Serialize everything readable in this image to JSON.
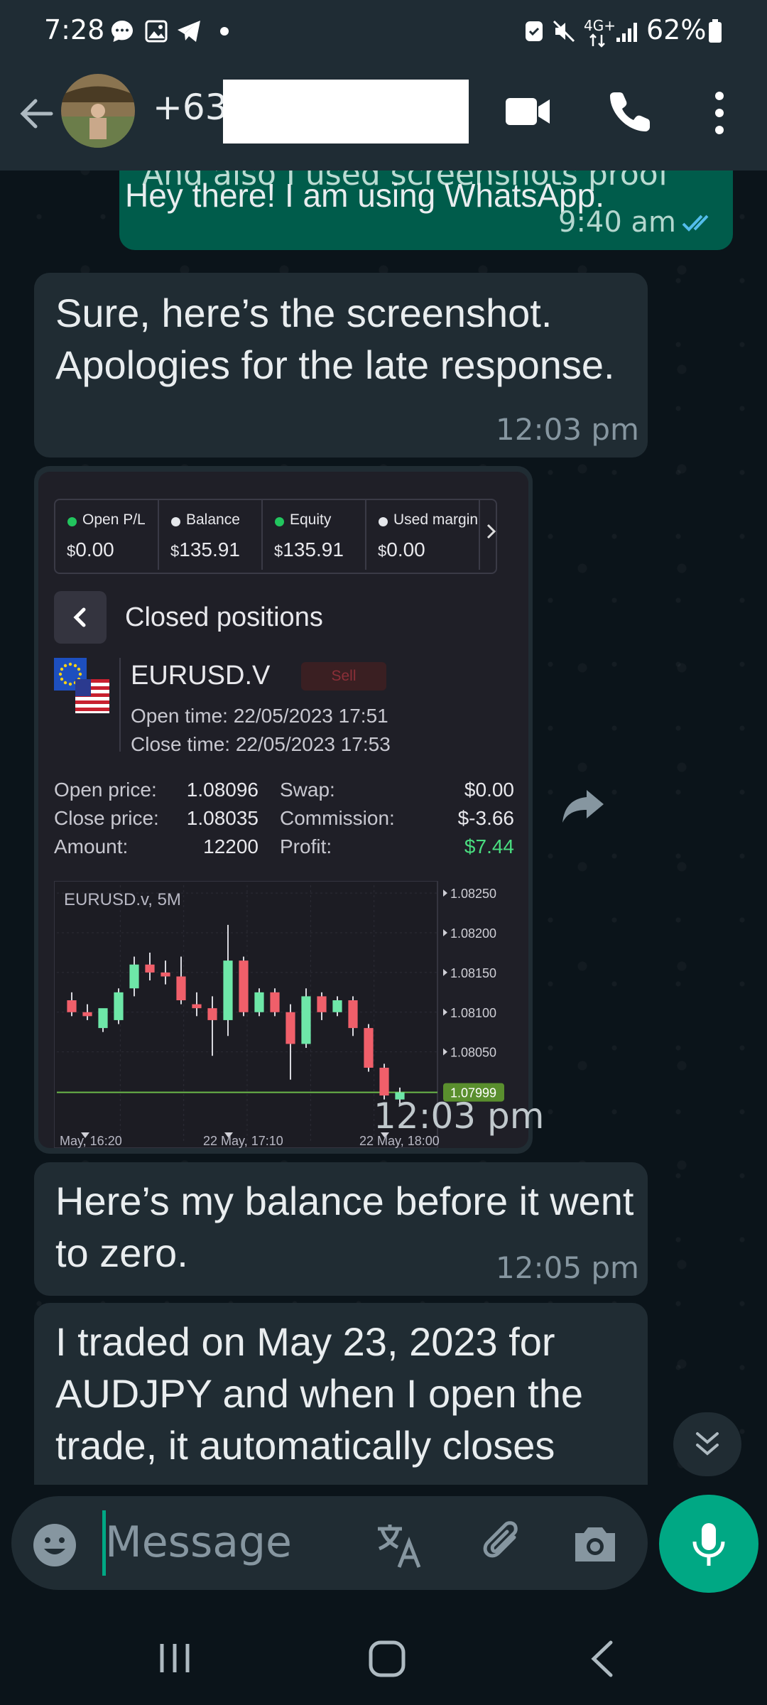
{
  "status_bar": {
    "time": "7:28",
    "network": "4G+",
    "battery": "62%"
  },
  "header": {
    "contact_name": "+63"
  },
  "messages": [
    {
      "type": "outgoing_partial",
      "cut_text": "And also I used screenshots proof",
      "text": "Hey there! I am using WhatsApp.",
      "time": "9:40 am"
    },
    {
      "type": "incoming",
      "text": "Sure, here’s the screenshot. Apologies for the late response.",
      "time": "12:03 pm"
    },
    {
      "type": "incoming_image",
      "time": "12:03 pm"
    },
    {
      "type": "incoming",
      "text": "Here’s my balance before it went to zero.",
      "time": "12:05 pm"
    },
    {
      "type": "incoming",
      "text": "I traded on May 23, 2023 for AUDJPY and when I open the trade, it automatically closes"
    }
  ],
  "screenshot": {
    "stats": [
      {
        "label": "Open P/L",
        "currency": "$",
        "value": "0.00",
        "dot": "#22c55e"
      },
      {
        "label": "Balance",
        "currency": "$",
        "value": "135.91",
        "dot": "#e5e7eb"
      },
      {
        "label": "Equity",
        "currency": "$",
        "value": "135.91",
        "dot": "#22c55e"
      },
      {
        "label": "Used margin",
        "currency": "$",
        "value": "0.00",
        "dot": "#e5e7eb"
      }
    ],
    "section_title": "Closed positions",
    "symbol": "EURUSD.V",
    "side": "Sell",
    "open_time": "Open time: 22/05/2023 17:51",
    "close_time": "Close time: 22/05/2023 17:53",
    "details_left": [
      {
        "label": "Open price:",
        "value": "1.08096"
      },
      {
        "label": "Close price:",
        "value": "1.08035"
      },
      {
        "label": "Amount:",
        "value": "12200"
      }
    ],
    "details_right": [
      {
        "label": "Swap:",
        "value": "$0.00"
      },
      {
        "label": "Commission:",
        "value": "$-3.66"
      },
      {
        "label": "Profit:",
        "value": "$7.44"
      }
    ]
  },
  "chart_data": {
    "type": "candlestick",
    "title": "EURUSD.v, 5M",
    "y_ticks": [
      "1.08250",
      "1.08200",
      "1.08150",
      "1.08100",
      "1.08050"
    ],
    "current_price": "1.07999",
    "x_ticks": [
      "May, 16:20",
      "22 May, 17:10",
      "22 May, 18:00"
    ],
    "ylim": [
      1.0797,
      1.0826
    ],
    "candles": [
      {
        "o": 1.08115,
        "h": 1.08125,
        "l": 1.08095,
        "c": 1.081
      },
      {
        "o": 1.081,
        "h": 1.0811,
        "l": 1.0809,
        "c": 1.08095
      },
      {
        "o": 1.0808,
        "h": 1.081,
        "l": 1.08075,
        "c": 1.08105
      },
      {
        "o": 1.0809,
        "h": 1.0813,
        "l": 1.08085,
        "c": 1.08125
      },
      {
        "o": 1.0813,
        "h": 1.0817,
        "l": 1.0812,
        "c": 1.0816
      },
      {
        "o": 1.0816,
        "h": 1.08175,
        "l": 1.0814,
        "c": 1.0815
      },
      {
        "o": 1.0815,
        "h": 1.08165,
        "l": 1.08135,
        "c": 1.08145
      },
      {
        "o": 1.08145,
        "h": 1.0817,
        "l": 1.0811,
        "c": 1.08115
      },
      {
        "o": 1.0811,
        "h": 1.08125,
        "l": 1.08095,
        "c": 1.08105
      },
      {
        "o": 1.08105,
        "h": 1.0812,
        "l": 1.08045,
        "c": 1.0809
      },
      {
        "o": 1.0809,
        "h": 1.0821,
        "l": 1.0807,
        "c": 1.08165
      },
      {
        "o": 1.08165,
        "h": 1.0817,
        "l": 1.08095,
        "c": 1.081
      },
      {
        "o": 1.081,
        "h": 1.0813,
        "l": 1.08095,
        "c": 1.08125
      },
      {
        "o": 1.08125,
        "h": 1.0813,
        "l": 1.08095,
        "c": 1.081
      },
      {
        "o": 1.081,
        "h": 1.0811,
        "l": 1.08015,
        "c": 1.0806
      },
      {
        "o": 1.0806,
        "h": 1.0813,
        "l": 1.08055,
        "c": 1.0812
      },
      {
        "o": 1.0812,
        "h": 1.08125,
        "l": 1.0809,
        "c": 1.081
      },
      {
        "o": 1.081,
        "h": 1.0812,
        "l": 1.08095,
        "c": 1.08115
      },
      {
        "o": 1.08115,
        "h": 1.0812,
        "l": 1.0807,
        "c": 1.0808
      },
      {
        "o": 1.0808,
        "h": 1.08085,
        "l": 1.08025,
        "c": 1.0803
      },
      {
        "o": 1.0803,
        "h": 1.08035,
        "l": 1.0799,
        "c": 1.07995
      },
      {
        "o": 1.0799,
        "h": 1.08005,
        "l": 1.07985,
        "c": 1.07999
      }
    ]
  },
  "input": {
    "placeholder": "Message"
  },
  "colors": {
    "accent": "#00a884",
    "incoming_bubble": "#202c33",
    "outgoing_bubble": "#005c4b",
    "bull": "#6ee7a8",
    "bear": "#f05f6a",
    "profit": "#4ade80"
  }
}
